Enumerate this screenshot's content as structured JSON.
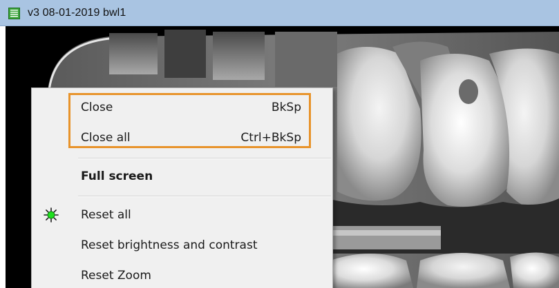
{
  "window": {
    "title": "v3  08-01-2019  bwl1",
    "icon": "list-document-icon"
  },
  "context_menu": {
    "highlight_color": "#e8932a",
    "items": [
      {
        "label": "Close",
        "shortcut": "BkSp"
      },
      {
        "label": "Close all",
        "shortcut": "Ctrl+BkSp"
      },
      {
        "label": "Full screen"
      },
      {
        "label": "Reset all",
        "icon": "green-sun-icon"
      },
      {
        "label": "Reset brightness and contrast"
      },
      {
        "label": "Reset Zoom"
      }
    ]
  },
  "viewer": {
    "content": "dental-xray-image"
  }
}
